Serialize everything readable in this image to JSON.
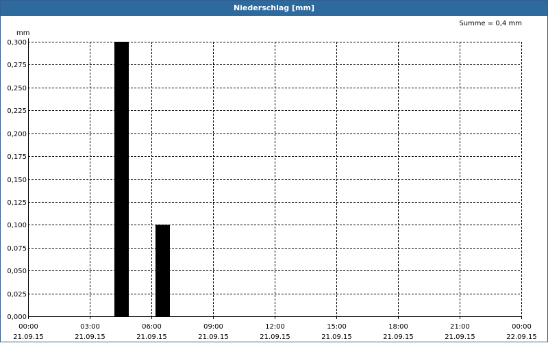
{
  "window": {
    "title": "Niederschlag [mm]"
  },
  "chart_data": {
    "type": "bar",
    "title": "Niederschlag [mm]",
    "ylabel": "mm",
    "xlabel": "",
    "summary": "Summe = 0,4 mm",
    "ylim": [
      0,
      0.3
    ],
    "yticks": [
      {
        "v": 0,
        "label": "0,000"
      },
      {
        "v": 0.025,
        "label": "0,025"
      },
      {
        "v": 0.05,
        "label": "0,050"
      },
      {
        "v": 0.075,
        "label": "0,075"
      },
      {
        "v": 0.1,
        "label": "0,100"
      },
      {
        "v": 0.125,
        "label": "0,125"
      },
      {
        "v": 0.15,
        "label": "0,150"
      },
      {
        "v": 0.175,
        "label": "0,175"
      },
      {
        "v": 0.2,
        "label": "0,200"
      },
      {
        "v": 0.225,
        "label": "0,225"
      },
      {
        "v": 0.25,
        "label": "0,250"
      },
      {
        "v": 0.275,
        "label": "0,275"
      },
      {
        "v": 0.3,
        "label": "0,300"
      }
    ],
    "xlim_hours": [
      0,
      24
    ],
    "xticks": [
      {
        "h": 0,
        "time": "00:00",
        "date": "21.09.15"
      },
      {
        "h": 3,
        "time": "03:00",
        "date": "21.09.15"
      },
      {
        "h": 6,
        "time": "06:00",
        "date": "21.09.15"
      },
      {
        "h": 9,
        "time": "09:00",
        "date": "21.09.15"
      },
      {
        "h": 12,
        "time": "12:00",
        "date": "21.09.15"
      },
      {
        "h": 15,
        "time": "15:00",
        "date": "21.09.15"
      },
      {
        "h": 18,
        "time": "18:00",
        "date": "21.09.15"
      },
      {
        "h": 21,
        "time": "21:00",
        "date": "21.09.15"
      },
      {
        "h": 24,
        "time": "00:00",
        "date": "22.09.15"
      }
    ],
    "bars": [
      {
        "start_h": 4.2,
        "end_h": 4.9,
        "value": 0.3
      },
      {
        "start_h": 6.2,
        "end_h": 6.9,
        "value": 0.1
      }
    ],
    "grid": true,
    "bar_color": "#000000"
  }
}
